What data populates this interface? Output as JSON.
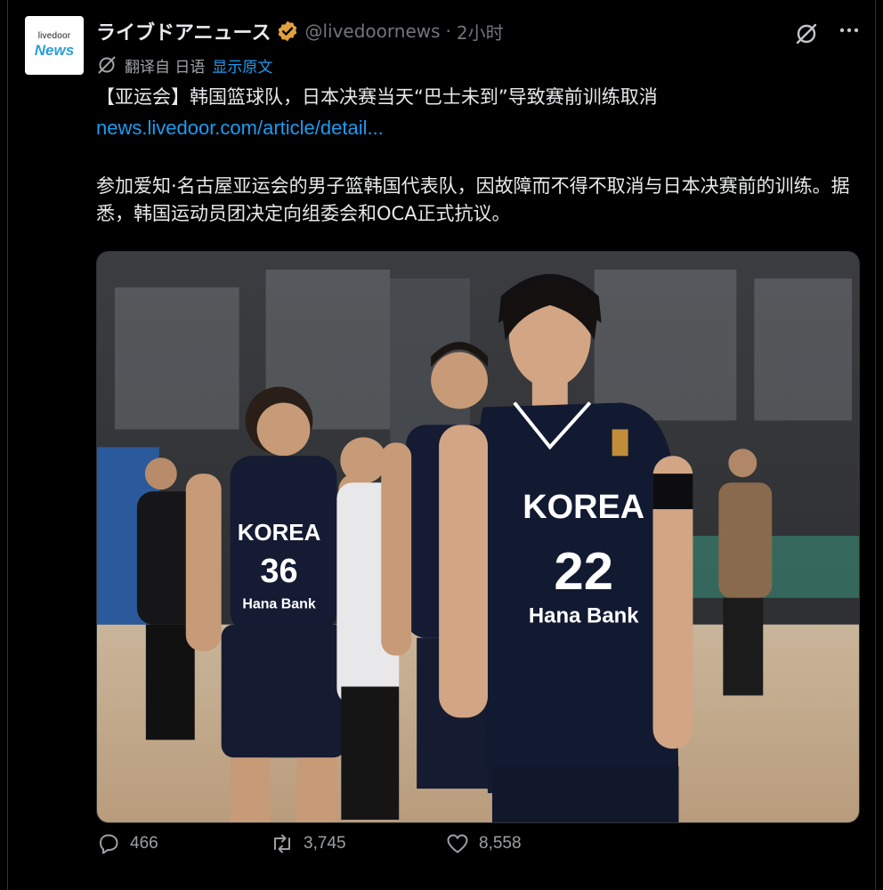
{
  "account": {
    "avatar_line1": "livedoor",
    "avatar_line2": "News",
    "display_name": "ライブドアニュース",
    "handle": "@livedoornews",
    "separator": "·",
    "time": "2小时"
  },
  "translation": {
    "label": "翻译自 日语",
    "show_original": "显示原文"
  },
  "post": {
    "headline": "【亚运会】韩国篮球队，日本决赛当天“巴士未到”导致赛前训练取消",
    "link": "news.livedoor.com/article/detail...",
    "body": "参加爱知·名古屋亚运会的男子篮韩国代表队，因故障而不得不取消与日本决赛前的训练。据悉，韩国运动员团决定向组委会和OCA正式抗议。"
  },
  "media": {
    "jersey_team": "KOREA",
    "numbers": [
      "36",
      "22"
    ],
    "sponsor": "Hana Bank"
  },
  "stats": {
    "replies": "466",
    "reposts": "3,745",
    "likes": "8,558"
  },
  "colors": {
    "link": "#1d9bf0",
    "verified": "#e0a23b",
    "muted": "#71767b"
  },
  "icons": [
    "verified-badge-icon",
    "grok-icon",
    "more-icon",
    "translate-icon",
    "reply-icon",
    "repost-icon",
    "like-icon"
  ]
}
